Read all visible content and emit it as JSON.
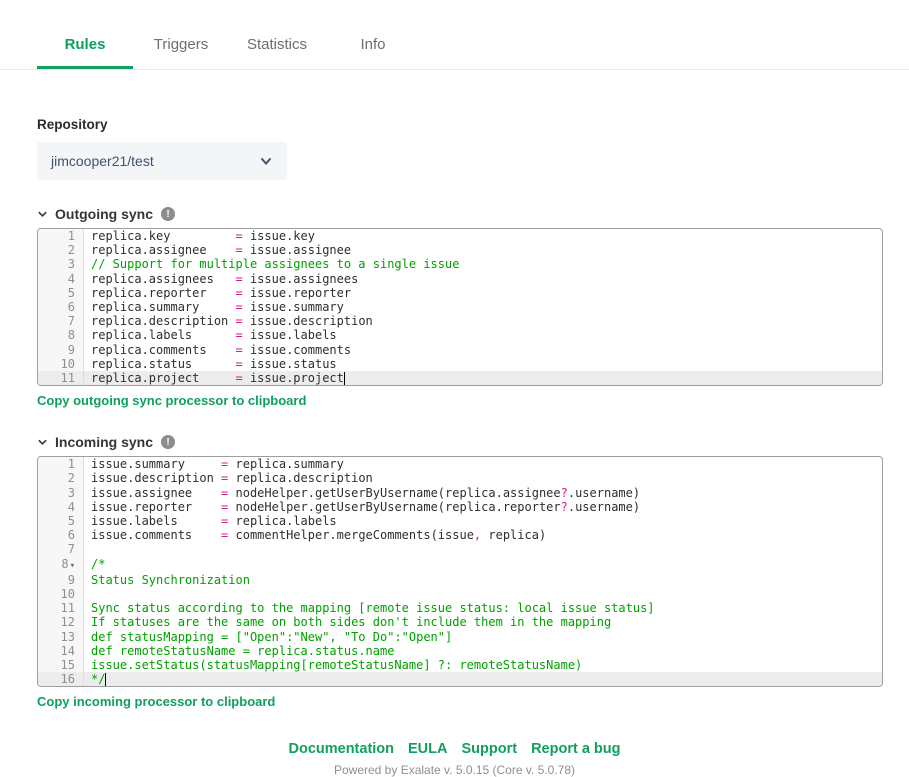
{
  "tabs": [
    {
      "label": "Rules",
      "active": true
    },
    {
      "label": "Triggers",
      "active": false
    },
    {
      "label": "Statistics",
      "active": false
    },
    {
      "label": "Info",
      "active": false
    }
  ],
  "repository": {
    "label": "Repository",
    "value": "jimcooper21/test"
  },
  "sections": [
    {
      "title": "Outgoing sync",
      "copy_link": "Copy outgoing sync processor to clipboard",
      "lines": [
        {
          "n": 1,
          "seg": [
            [
              "t",
              "replica.key         "
            ],
            [
              "o",
              "="
            ],
            [
              "t",
              " issue.key"
            ]
          ]
        },
        {
          "n": 2,
          "seg": [
            [
              "t",
              "replica.assignee    "
            ],
            [
              "o",
              "="
            ],
            [
              "t",
              " issue.assignee"
            ]
          ]
        },
        {
          "n": 3,
          "seg": [
            [
              "c",
              "// Support for multiple assignees to a single issue"
            ]
          ]
        },
        {
          "n": 4,
          "seg": [
            [
              "t",
              "replica.assignees   "
            ],
            [
              "o",
              "="
            ],
            [
              "t",
              " issue.assignees"
            ]
          ]
        },
        {
          "n": 5,
          "seg": [
            [
              "t",
              "replica.reporter    "
            ],
            [
              "o",
              "="
            ],
            [
              "t",
              " issue.reporter"
            ]
          ]
        },
        {
          "n": 6,
          "seg": [
            [
              "t",
              "replica.summary     "
            ],
            [
              "o",
              "="
            ],
            [
              "t",
              " issue.summary"
            ]
          ]
        },
        {
          "n": 7,
          "seg": [
            [
              "t",
              "replica.description "
            ],
            [
              "o",
              "="
            ],
            [
              "t",
              " issue.description"
            ]
          ]
        },
        {
          "n": 8,
          "seg": [
            [
              "t",
              "replica.labels      "
            ],
            [
              "o",
              "="
            ],
            [
              "t",
              " issue.labels"
            ]
          ]
        },
        {
          "n": 9,
          "seg": [
            [
              "t",
              "replica.comments    "
            ],
            [
              "o",
              "="
            ],
            [
              "t",
              " issue.comments"
            ]
          ]
        },
        {
          "n": 10,
          "seg": [
            [
              "t",
              "replica.status      "
            ],
            [
              "o",
              "="
            ],
            [
              "t",
              " issue.status"
            ]
          ]
        },
        {
          "n": 11,
          "seg": [
            [
              "t",
              "replica.project     "
            ],
            [
              "o",
              "="
            ],
            [
              "t",
              " issue.project"
            ]
          ],
          "active": true,
          "cursor": true
        }
      ]
    },
    {
      "title": "Incoming sync",
      "copy_link": "Copy incoming processor to clipboard",
      "lines": [
        {
          "n": 1,
          "seg": [
            [
              "t",
              "issue.summary     "
            ],
            [
              "o",
              "="
            ],
            [
              "t",
              " replica.summary"
            ]
          ]
        },
        {
          "n": 2,
          "seg": [
            [
              "t",
              "issue.description "
            ],
            [
              "o",
              "="
            ],
            [
              "t",
              " replica.description"
            ]
          ]
        },
        {
          "n": 3,
          "seg": [
            [
              "t",
              "issue.assignee    "
            ],
            [
              "o",
              "="
            ],
            [
              "t",
              " nodeHelper.getUserByUsername(replica.assignee"
            ],
            [
              "o",
              "?"
            ],
            [
              "t",
              ".username)"
            ]
          ]
        },
        {
          "n": 4,
          "seg": [
            [
              "t",
              "issue.reporter    "
            ],
            [
              "o",
              "="
            ],
            [
              "t",
              " nodeHelper.getUserByUsername(replica.reporter"
            ],
            [
              "o",
              "?"
            ],
            [
              "t",
              ".username)"
            ]
          ]
        },
        {
          "n": 5,
          "seg": [
            [
              "t",
              "issue.labels      "
            ],
            [
              "o",
              "="
            ],
            [
              "t",
              " replica.labels"
            ]
          ]
        },
        {
          "n": 6,
          "seg": [
            [
              "t",
              "issue.comments    "
            ],
            [
              "o",
              "="
            ],
            [
              "t",
              " commentHelper.mergeComments(issue"
            ],
            [
              "o",
              ","
            ],
            [
              "t",
              " replica)"
            ]
          ]
        },
        {
          "n": 7,
          "seg": []
        },
        {
          "n": 8,
          "seg": [
            [
              "c",
              "/*"
            ]
          ],
          "fold": true
        },
        {
          "n": 9,
          "seg": [
            [
              "c",
              "Status Synchronization"
            ]
          ]
        },
        {
          "n": 10,
          "seg": []
        },
        {
          "n": 11,
          "seg": [
            [
              "c",
              "Sync status according to the mapping [remote issue status: local issue status]"
            ]
          ]
        },
        {
          "n": 12,
          "seg": [
            [
              "c",
              "If statuses are the same on both sides don't include them in the mapping"
            ]
          ]
        },
        {
          "n": 13,
          "seg": [
            [
              "c",
              "def statusMapping = [\"Open\":\"New\", \"To Do\":\"Open\"]"
            ]
          ]
        },
        {
          "n": 14,
          "seg": [
            [
              "c",
              "def remoteStatusName = replica.status.name"
            ]
          ]
        },
        {
          "n": 15,
          "seg": [
            [
              "c",
              "issue.setStatus(statusMapping[remoteStatusName] ?: remoteStatusName)"
            ]
          ]
        },
        {
          "n": 16,
          "seg": [
            [
              "c",
              "*/"
            ]
          ],
          "active": true,
          "cursor": true
        }
      ]
    }
  ],
  "footer": {
    "links": [
      "Documentation",
      "EULA",
      "Support",
      "Report a bug"
    ],
    "powered_by": "Powered by Exalate v. 5.0.15 (Core v. 5.0.78)"
  },
  "colors": {
    "accent_green": "#0fa05f",
    "code_comment": "#00a000",
    "code_operator": "#d81b8c",
    "code_text": "#2e2e2e"
  }
}
